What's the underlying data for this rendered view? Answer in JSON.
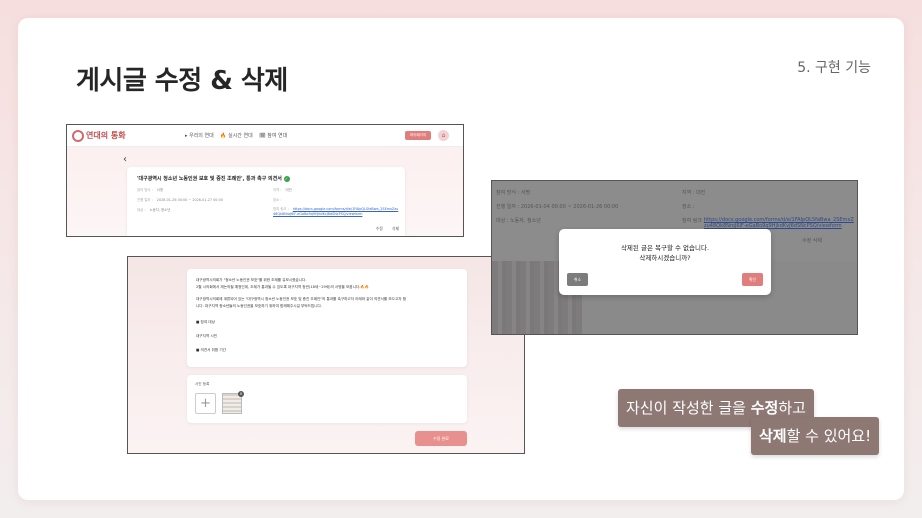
{
  "slide": {
    "title": "게시글 수정 & 삭제",
    "section": "5. 구현 기능"
  },
  "shot1": {
    "logo": "연대의 통화",
    "nav_links": [
      "▸ 우리의 연대",
      "🔥 실시간 연대",
      "🗓 참여 연대"
    ],
    "mypage_button": "마이페이지",
    "home_icon": "home-icon",
    "back_icon": "chevron-left-icon",
    "post_title": "'대구광역시 청소년 노동인권 보호 및 증진 조례안', 통과 촉구 의견서",
    "meta_left": [
      {
        "label": "참여 방식 :",
        "value": "서명"
      },
      {
        "label": "진행 일자 :",
        "value": "2026-01-26 00:00 ~ 2026-01-27 00:00"
      },
      {
        "label": "대상 :",
        "value": "노동자, 청소년"
      }
    ],
    "meta_right": [
      {
        "label": "지역 :",
        "value": "대전"
      },
      {
        "label": "장소 :",
        "value": ""
      },
      {
        "label": "참여 링크 :",
        "value": "https://docs.google.com/forms/d/e/1FAIpQLSfaBwa_2SEmxZzu48Qk8NroJ6lF-eGaBo9q9HjkdKvJ6dSNcPSQ/viewform"
      }
    ],
    "actions": [
      "수정",
      "삭제"
    ]
  },
  "shot2": {
    "body_lines": [
      "대구광역시의회가 \"청소년 노동인권 보호\"를 위한 조례를 유보시켰습니다.",
      "2월 시의회에서 재논의될 예정인데, 조례가 통과될 수 있도록 대구지역 청년(18세~29세)의 서명을 모읍니다.🔥🔥",
      "대구광역시의회에 계류되어 있는 \"대구광역시 청소년 노동인권 보호 및 증진 조례안\"의 통과를 촉구하고자 아래와 같이 의견서를 모으고자 합",
      "니다. 대구지역 청소년들의 노동인권을 보호하기 위하여 함께해주시길 부탁드립니다.",
      "■ 참여 대상",
      "대구지역 시민",
      "■ 의견서 취합 기간"
    ],
    "photo_label": "사진 등록",
    "add_icon": "plus-icon",
    "submit_button": "수정 완료"
  },
  "shot3": {
    "bg_rows": [
      {
        "left": "참여 방식 :   서명",
        "right": "지역 :   대전"
      },
      {
        "left": "진행 일자 :   2026-01-04 00:00 ~ 2026-01-26 00:00",
        "right": "장소 :"
      },
      {
        "left": "대상 :   노동자, 청소년",
        "right": "참여 링크 :"
      }
    ],
    "bg_link": "https://docs.google.com/forms/d/e/1FAIpQLSfaBwa_2SEmxZzu48Qk8NroJ6lF-eGaBo9q9HjkdKvJ6dSNcPSQ/viewform",
    "bg_actions": "수정    삭제",
    "modal_line1": "삭제된 글은 복구할 수 없습니다.",
    "modal_line2": "삭제하시겠습니까?",
    "cancel": "취소",
    "confirm": "확인"
  },
  "callouts": {
    "line1_pre": "자신이 작성한 글을 ",
    "line1_bold": "수정",
    "line1_post": "하고",
    "line2_bold": "삭제",
    "line2_post": "할 수 있어요!"
  },
  "colors": {
    "accent": "#e07d7d",
    "callout_bg": "#8d7874",
    "card_bg": "#ffffff"
  }
}
